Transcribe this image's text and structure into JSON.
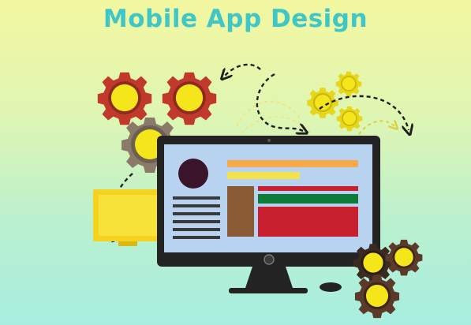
{
  "banner": {
    "title": "Mobile App Design"
  },
  "colors": {
    "title_text": "#3fc7c7",
    "gear_red": "#c0392b",
    "gear_gray": "#8a7a6a",
    "gear_brown": "#5b3a2a",
    "gear_center_yellow": "#f5e61c",
    "monitor_frame": "#232323",
    "screen_bg": "#b8d3f0",
    "bar_orange": "#f7a94a",
    "bar_yellow": "#f4e24a",
    "bar_red": "#c8202e",
    "bar_green": "#0d7a3a",
    "block_brown": "#8a5a35",
    "avatar_purple": "#3a1428"
  },
  "icons": [
    "gear-icon",
    "monitor-icon",
    "phone-icon",
    "mouse-icon",
    "dashed-arrow-icon",
    "power-button-icon"
  ]
}
